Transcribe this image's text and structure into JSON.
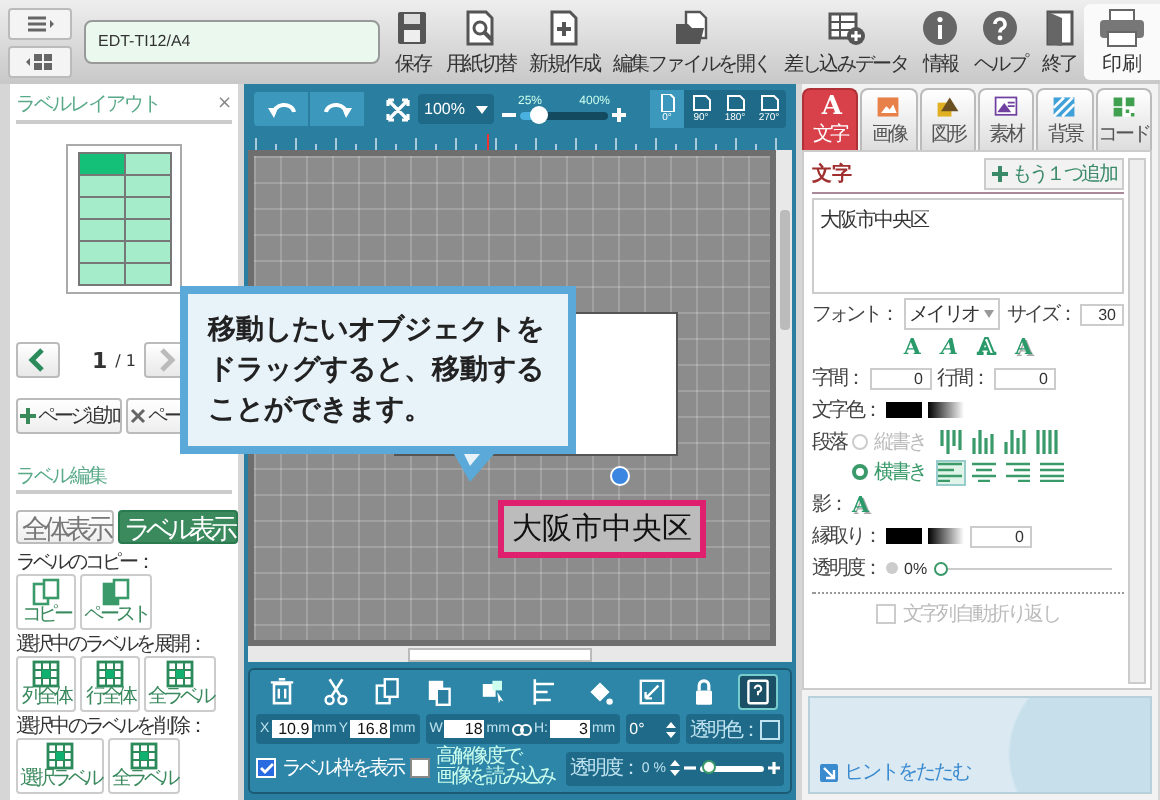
{
  "toolbar": {
    "file_name": "EDT-TI12/A4",
    "actions": [
      {
        "label": "保存"
      },
      {
        "label": "用紙切替"
      },
      {
        "label": "新規作成"
      },
      {
        "label": "編集ファイルを開く"
      },
      {
        "label": "差し込みデータ"
      },
      {
        "label": "情報"
      },
      {
        "label": "ヘルプ"
      },
      {
        "label": "終了"
      }
    ],
    "print": "印刷"
  },
  "layout_panel": {
    "title": "ラベルレイアウト",
    "close": "×",
    "label_grid": [
      {
        "selected": true
      },
      {
        "selected": false
      },
      {
        "selected": false
      },
      {
        "selected": false
      },
      {
        "selected": false
      },
      {
        "selected": false
      },
      {
        "selected": false
      },
      {
        "selected": false
      },
      {
        "selected": false
      },
      {
        "selected": false
      },
      {
        "selected": false
      },
      {
        "selected": false
      }
    ],
    "page": "1",
    "page_total": "/ 1",
    "add_page": "ページ追加",
    "delete_page": "ペー",
    "section": "ラベル編集",
    "view_buttons": [
      {
        "label": "全体表示",
        "selected": false
      },
      {
        "label": "ラベル表示",
        "selected": true
      }
    ],
    "groups": [
      {
        "title": "ラベルのコピー：",
        "buttons": [
          "コピー",
          "ペースト"
        ]
      },
      {
        "title": "選択中のラベルを展開：",
        "buttons": [
          "列全体",
          "行全体",
          "全ラベル"
        ]
      },
      {
        "title": "選択中のラベルを削除：",
        "buttons": [
          "選択ラベル",
          "全ラベル"
        ]
      }
    ]
  },
  "editor": {
    "zoom": {
      "value": "100%",
      "min": "25%",
      "max": "400%",
      "level": 0.2
    },
    "rotations": [
      {
        "label": "0°",
        "selected": true
      },
      {
        "label": "90°",
        "selected": false
      },
      {
        "label": "180°",
        "selected": false
      },
      {
        "label": "270°",
        "selected": false
      }
    ],
    "text_object": "大阪市中央区",
    "callout": "移動したいオブジェクトをドラッグすると、移動することができます。",
    "tools": [
      {
        "selected": false
      },
      {
        "selected": false
      },
      {
        "selected": false
      },
      {
        "selected": false
      },
      {
        "selected": false
      },
      {
        "selected": false
      },
      {
        "selected": false
      },
      {
        "selected": false
      },
      {
        "selected": false
      },
      {
        "selected": true
      }
    ],
    "position": [
      {
        "label": "X",
        "value": "10.9",
        "unit": "mm"
      },
      {
        "label": "Y",
        "value": "16.8",
        "unit": "mm"
      }
    ],
    "size": [
      {
        "label": "W",
        "value": "18",
        "unit": "mm"
      },
      {
        "label": "H:",
        "value": "3",
        "unit": "mm"
      }
    ],
    "angle": "0°",
    "transparent_color": {
      "label": "透明色：",
      "checked": false
    },
    "show_frame": {
      "label": "ラベル枠を表示",
      "checked": true
    },
    "hires": {
      "label_lines": [
        "高解像度で",
        "画像を読み込み"
      ],
      "checked": false
    },
    "opacity": {
      "label": "透明度：",
      "value": "0",
      "unit": "%",
      "level": 0.12
    }
  },
  "right_panel": {
    "tabs": [
      {
        "label": "文字",
        "glyph": "A",
        "selected": true
      },
      {
        "label": "画像",
        "selected": false
      },
      {
        "label": "図形",
        "selected": false
      },
      {
        "label": "素材",
        "selected": false
      },
      {
        "label": "背景",
        "selected": false
      },
      {
        "label": "コード",
        "selected": false
      }
    ],
    "title": "文字",
    "add": "もう１つ追加",
    "text": "大阪市中央区",
    "font_label": "フォント：",
    "font": "メイリオ",
    "size_label": "サイズ：",
    "size": "30",
    "style_buttons": [
      "A",
      "A",
      "A",
      "A"
    ],
    "spacing_label": "字間：",
    "spacing": "0",
    "line_label": "行間：",
    "line": "0",
    "color_label": "文字色：",
    "paragraph_label": "段落",
    "directions": [
      {
        "label": "縦書き",
        "selected": false
      },
      {
        "label": "横書き",
        "selected": true
      }
    ],
    "halign": [
      {
        "selected": true
      },
      {
        "selected": false
      },
      {
        "selected": false
      },
      {
        "selected": false
      }
    ],
    "shadow_label": "影：",
    "shadow_glyph": "A",
    "outline_label": "縁取り：",
    "outline": "0",
    "opacity_label": "透明度：",
    "opacity_meter": {
      "value": "0%",
      "level": 0
    },
    "wrap": {
      "label": "文字列自動折り返し",
      "checked": false
    },
    "hint": "ヒントをたたむ"
  }
}
